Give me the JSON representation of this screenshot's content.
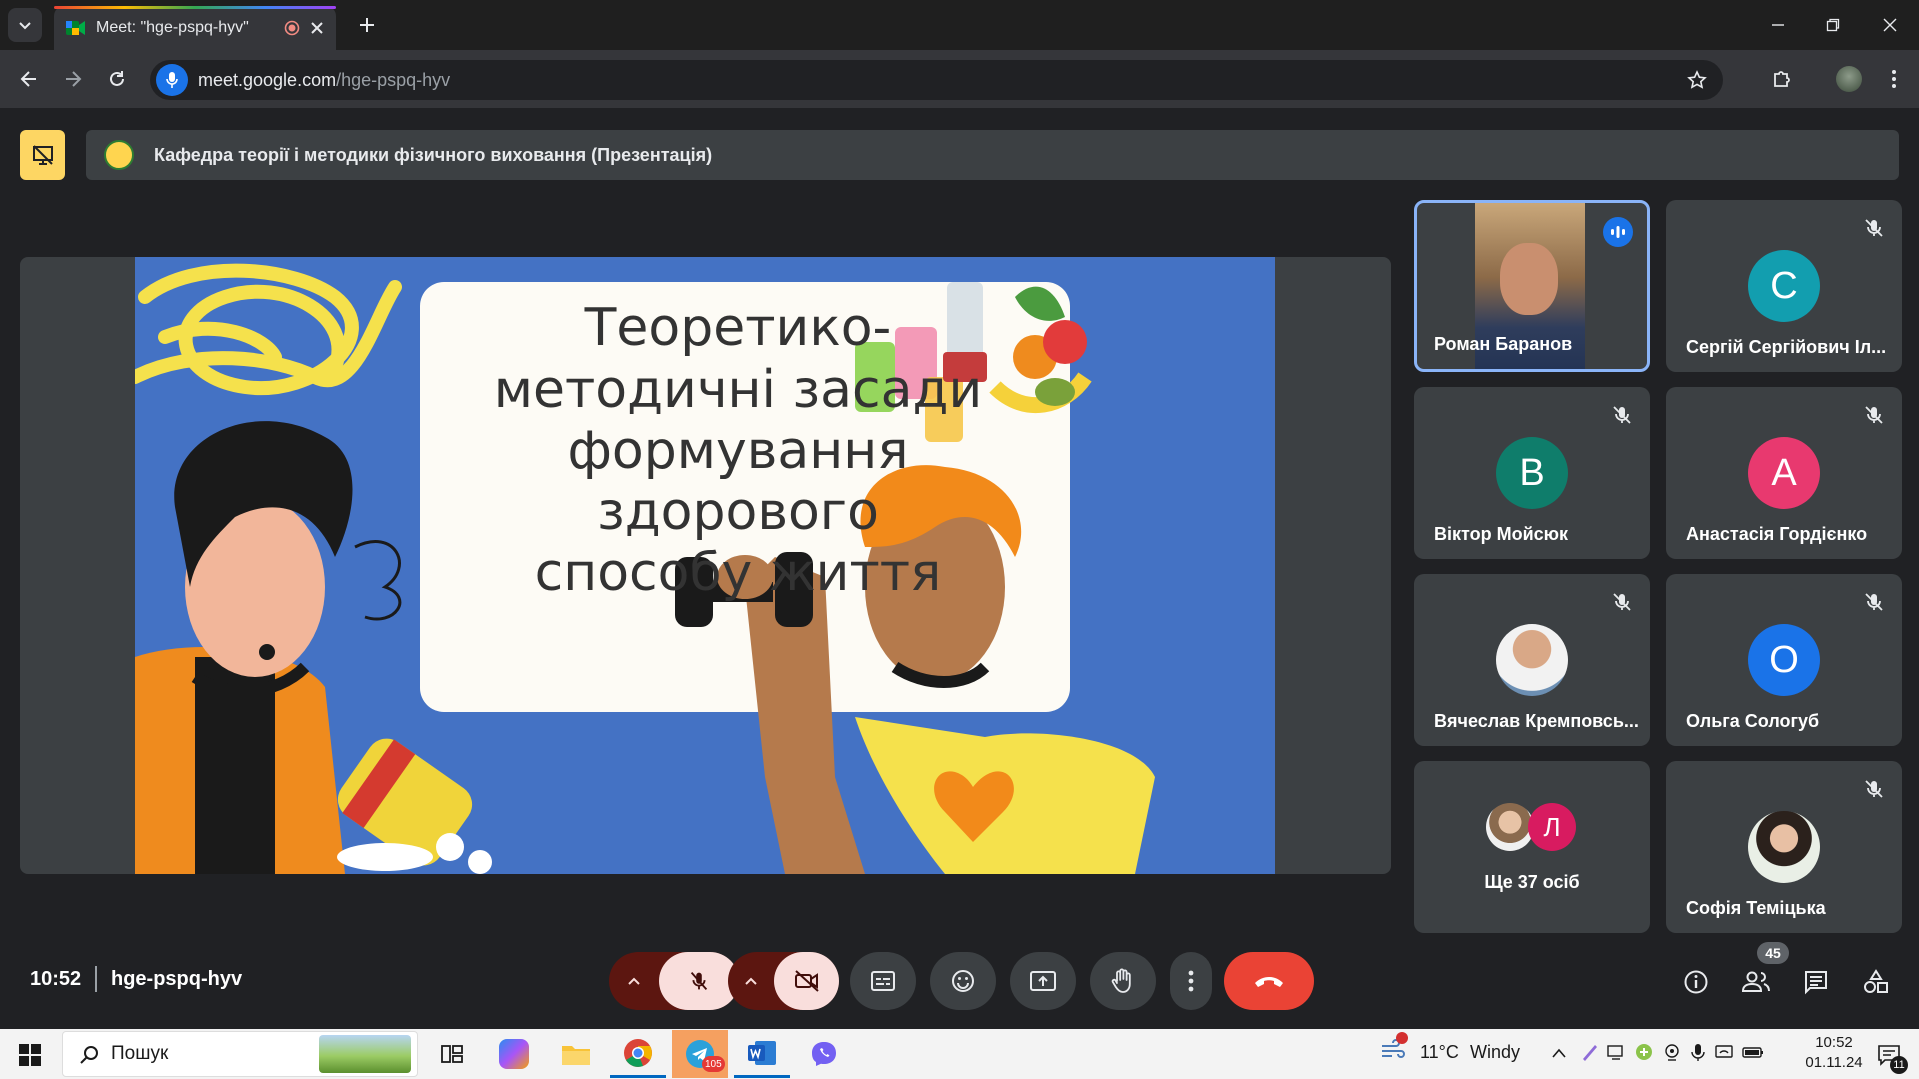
{
  "browser": {
    "tab_title": "Meet: \"hge-pspq-hyv\"",
    "url_host": "meet.google.com",
    "url_path": "/hge-pspq-hyv"
  },
  "meet": {
    "presentation_banner": "Кафедра теорії і методики фізичного виховання (Презентація)",
    "slide_title_lines": [
      "Теоретико-",
      "методичні засади",
      "формування",
      "здорового",
      "способу життя"
    ],
    "participants": [
      {
        "name": "Роман Баранов",
        "initial": "",
        "avatar_color": "",
        "speaking": true
      },
      {
        "name": "Сергій Сергійович Іл...",
        "initial": "С",
        "avatar_color": "#129eaf",
        "muted": true
      },
      {
        "name": "Віктор Мойсюк",
        "initial": "В",
        "avatar_color": "#0f7d6b",
        "muted": true
      },
      {
        "name": "Анастасія Гордієнко",
        "initial": "А",
        "avatar_color": "#e8396f",
        "muted": true
      },
      {
        "name": "Вячеслав Кремповсь...",
        "initial": "",
        "avatar_color": "",
        "muted": true
      },
      {
        "name": "Ольга Сологуб",
        "initial": "О",
        "avatar_color": "#1a73e8",
        "muted": true
      },
      {
        "name": "Ще 37 осіб",
        "initial": "Л",
        "avatar_color": "#d81b60",
        "muted": false
      },
      {
        "name": "Софія Теміцька",
        "initial": "",
        "avatar_color": "",
        "muted": true
      }
    ],
    "time": "10:52",
    "meeting_code": "hge-pspq-hyv",
    "participant_count": "45",
    "colors": {
      "end_call": "#ea4335",
      "mic_off_bg": "#f9dedc",
      "speaking_border": "#8ab4f8",
      "accent": "#1a73e8"
    }
  },
  "taskbar": {
    "search_label": "Пошук",
    "weather_temp": "11°C",
    "weather_desc": "Windy",
    "clock_time": "10:52",
    "clock_date": "01.11.24",
    "notification_count": "11",
    "telegram_badge": "105"
  }
}
